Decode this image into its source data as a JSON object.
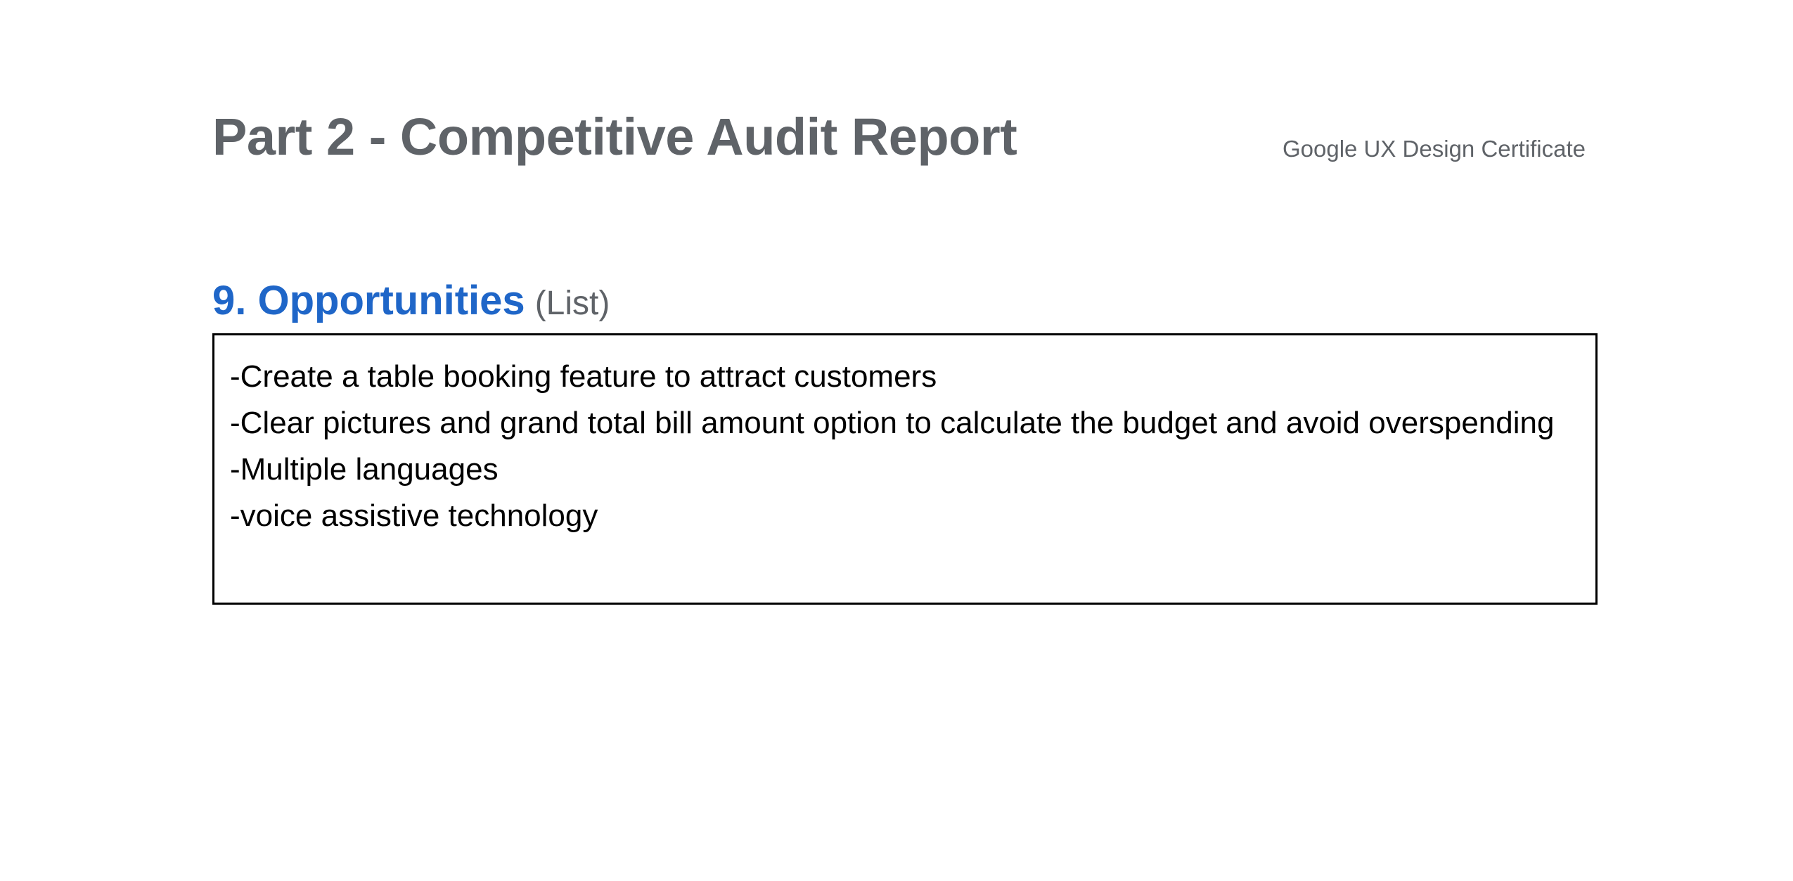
{
  "header": {
    "title": "Part 2 - Competitive Audit Report",
    "brand": "Google UX Design Certificate"
  },
  "section": {
    "heading": "9. Opportunities",
    "subheading": "(List)"
  },
  "opportunities": [
    "-Create a table booking feature to attract customers",
    "-Clear pictures and grand total bill amount option to calculate the budget and avoid overspending",
    "-Multiple languages",
    "-voice assistive technology"
  ]
}
